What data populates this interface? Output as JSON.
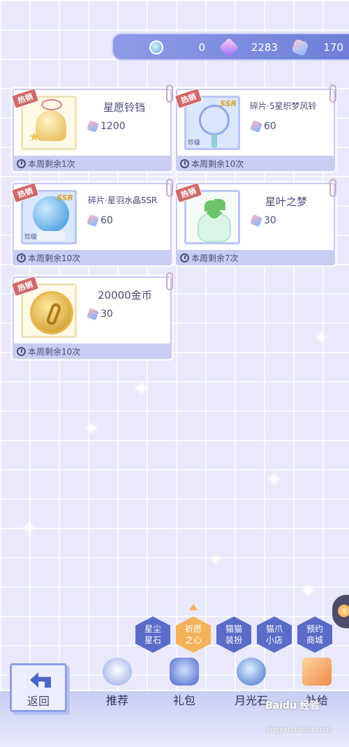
{
  "currency": [
    {
      "icon": "blue-orb-icon",
      "value": "0"
    },
    {
      "icon": "purple-star-gem-icon",
      "value": "2283"
    },
    {
      "icon": "pink-crystal-icon",
      "value": "170"
    }
  ],
  "items": [
    {
      "title": "星愿铃铛",
      "price": "1200",
      "limit": "本周剩余1次",
      "hot": "热销",
      "art": "bell-icon"
    },
    {
      "title": "碎片·5星织梦风铃",
      "price": "60",
      "limit": "本周剩余10次",
      "hot": "热销",
      "art": "dreamcatcher-icon",
      "rank": "珍级"
    },
    {
      "title": "碎片·星羽水晶SSR",
      "price": "60",
      "limit": "本周剩余10次",
      "hot": "热销",
      "art": "crystal-globe-icon",
      "badge": "SSR",
      "rank": "珍级"
    },
    {
      "title": "星叶之梦",
      "price": "30",
      "limit": "本周剩余7次",
      "hot": "热销",
      "art": "clover-jar-icon"
    },
    {
      "title": "20000金币",
      "price": "30",
      "limit": "本周剩余10次",
      "hot": "热销",
      "art": "gold-coin-icon"
    }
  ],
  "categories": [
    {
      "label": "星尘星石",
      "active": false
    },
    {
      "label": "祈愿之心",
      "active": true
    },
    {
      "label": "猫猫装扮",
      "active": false
    },
    {
      "label": "猫爪小店",
      "active": false
    },
    {
      "label": "预约商城",
      "active": false
    }
  ],
  "nav": {
    "back_label": "返回",
    "tabs": [
      {
        "label": "推荐",
        "icon": "swan-icon"
      },
      {
        "label": "礼包",
        "icon": "gift-icon"
      },
      {
        "label": "月光石",
        "icon": "moonstone-icon"
      },
      {
        "label": "补给",
        "icon": "shopping-bag-icon"
      }
    ]
  },
  "watermark": {
    "main": "Baidu 经验",
    "sub": "jingyan.baidu.com"
  },
  "colors": {
    "accent": "#f4b25a",
    "primary": "#5a6cc8",
    "background": "#e9e9fb"
  }
}
